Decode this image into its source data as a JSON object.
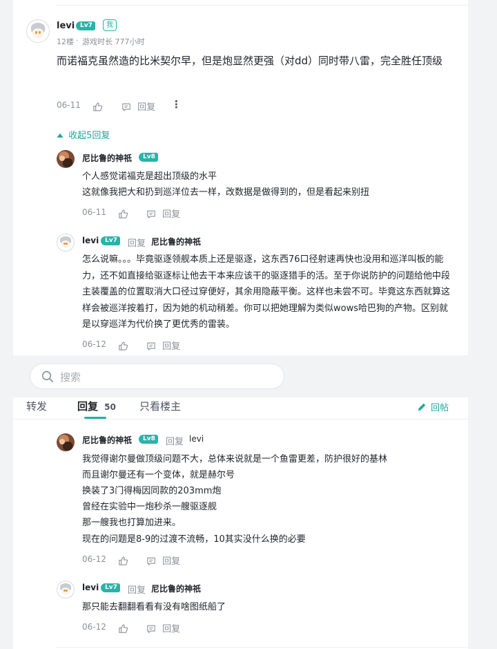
{
  "main_comment": {
    "user": "levi",
    "level": "Lv7",
    "me_badge": "我",
    "floor": "12楼",
    "separator": "·",
    "playtime": "游戏时长 777小时",
    "text": "而诺福克虽然造的比米契尔早，但是炮显然更强（对dd）同时带八雷，完全胜任顶级",
    "date": "06-11",
    "reply_label": "回复",
    "more": "⋮",
    "collapse_label": "收起5回复"
  },
  "replies_top": [
    {
      "user": "尼比鲁的神祇",
      "level": "Lv8",
      "lines": [
        "个人感觉诺福克是超出顶级的水平",
        "这就像我把大和扔到巡洋位去一样，改数据是做得到的，但是看起来别扭"
      ],
      "date": "06-11",
      "reply_label": "回复"
    },
    {
      "user": "levi",
      "level": "Lv7",
      "reply_word": "回复",
      "reply_to": "尼比鲁的神祇",
      "text": "怎么说嘛。。。毕竟驱逐领舰本质上还是驱逐，这东西76口径射速再快也没用和巡洋叫板的能力，还不如直接给驱逐标让他去干本来应该干的驱逐猎手的活。至于你说防护的问题给他中段主装覆盖的位置取消大口径过穿便好，其余用隐蔽平衡。这样也未尝不可。毕竟这东西就算这样会被巡洋按着打，因为她的机动稍差。你可以把她理解为类似wows哈巴狗的产物。区别就是以穿巡洋为代价换了更优秀的雷装。",
      "date": "06-12",
      "reply_label": "回复"
    }
  ],
  "search": {
    "placeholder": "搜索"
  },
  "tabs": {
    "repost": "转发",
    "reply": "回复",
    "reply_count": "50",
    "owner_only": "只看楼主",
    "post_button": "回帖"
  },
  "replies_bottom": [
    {
      "user": "尼比鲁的神祇",
      "level": "Lv8",
      "reply_word": "回复",
      "reply_to": "levi",
      "lines": [
        "我觉得谢尔曼做顶级问题不大，总体来说就是一个鱼雷更差，防护很好的基林",
        "而且谢尔曼还有一个变体，就是赫尔号",
        "换装了3门得梅因同款的203mm炮",
        "曾经在实验中一炮秒杀一艘驱逐舰",
        "那一艘我也打算加进来。",
        "现在的问题是8-9的过渡不流畅，10其实没什么换的必要"
      ],
      "date": "06-12",
      "reply_label": "回复"
    },
    {
      "user": "levi",
      "level": "Lv7",
      "reply_word": "回复",
      "reply_to": "尼比鲁的神祇",
      "lines": [
        "那只能去翻翻看看有没有啥图纸船了"
      ],
      "date": "06-12",
      "reply_label": "回复"
    }
  ],
  "colors": {
    "accent": "#1fb3a5",
    "lv_badge": "#29b3a9",
    "muted": "#8a9099"
  }
}
